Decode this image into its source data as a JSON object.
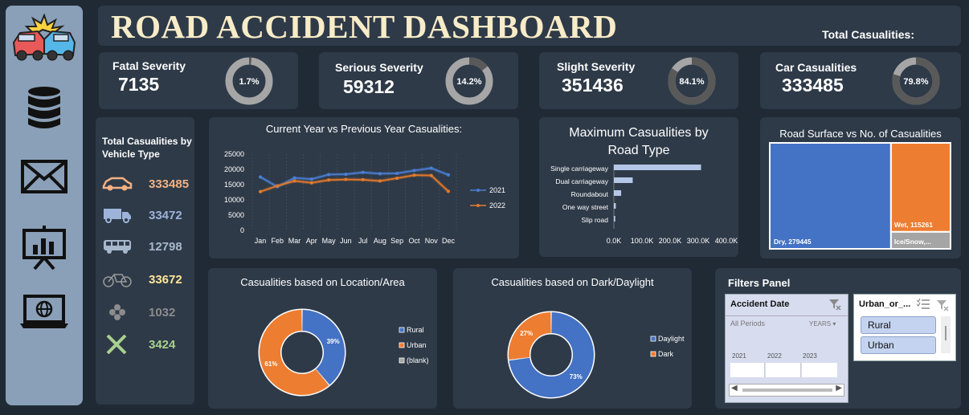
{
  "header": {
    "title": "ROAD ACCIDENT DASHBOARD",
    "total_casualties_label": "Total Casualities:"
  },
  "sidebar": {
    "icons": [
      "car-crash-icon",
      "database-icon",
      "mail-icon",
      "presentation-icon",
      "laptop-globe-icon"
    ]
  },
  "kpis": [
    {
      "label": "Fatal Severity",
      "value": "7135",
      "percent": "1.7%",
      "fraction": 0.017
    },
    {
      "label": "Serious Severity",
      "value": "59312",
      "percent": "14.2%",
      "fraction": 0.142
    },
    {
      "label": "Slight Severity",
      "value": "351436",
      "percent": "84.1%",
      "fraction": 0.841
    },
    {
      "label": "Car Casualities",
      "value": "333485",
      "percent": "79.8%",
      "fraction": 0.798
    }
  ],
  "vehicle_panel": {
    "title": "Total Casualities by Vehicle Type",
    "items": [
      {
        "icon": "car-icon",
        "value": "333485",
        "color": "#f4b183"
      },
      {
        "icon": "truck-icon",
        "value": "33472",
        "color": "#9db3d9"
      },
      {
        "icon": "bus-icon",
        "value": "12798",
        "color": "#a8b8cc"
      },
      {
        "icon": "bicycle-icon",
        "value": "33672",
        "color": "#ffe699"
      },
      {
        "icon": "flower-icon",
        "value": "1032",
        "color": "#8c8c8c"
      },
      {
        "icon": "cross-icon",
        "value": "3424",
        "color": "#a9d18e"
      }
    ]
  },
  "filters": {
    "title": "Filters Panel",
    "date_slicer": {
      "title": "Accident Date",
      "period": "All Periods",
      "unit": "YEARS",
      "years": [
        "2021",
        "2022",
        "2023"
      ]
    },
    "urban_slicer": {
      "title": "Urban_or_...",
      "options": [
        "Rural",
        "Urban"
      ]
    }
  },
  "chart_data": [
    {
      "type": "line",
      "title": "Current Year vs Previous Year Casualities:",
      "categories": [
        "Jan",
        "Feb",
        "Mar",
        "Apr",
        "May",
        "Jun",
        "Jul",
        "Aug",
        "Sep",
        "Oct",
        "Nov",
        "Dec"
      ],
      "yticks": [
        "25000",
        "20000",
        "15000",
        "10000",
        "5000",
        "0"
      ],
      "ylim": [
        0,
        25000
      ],
      "series": [
        {
          "name": "2021",
          "color": "#4a7fd4",
          "values": [
            17500,
            14300,
            17200,
            16800,
            18300,
            18400,
            19000,
            18600,
            18700,
            19600,
            20400,
            18200
          ]
        },
        {
          "name": "2022",
          "color": "#e57a2b",
          "values": [
            12700,
            14600,
            16200,
            15600,
            16500,
            16700,
            16600,
            16200,
            17100,
            18100,
            18000,
            12800
          ]
        }
      ]
    },
    {
      "type": "bar",
      "title": "Maximum Casualities by Road Type",
      "categories": [
        "Single carriageway",
        "Dual carriageway",
        "Roundabout",
        "One way street",
        "Slip road"
      ],
      "values": [
        310000,
        67000,
        26000,
        7000,
        5000
      ],
      "xticks": [
        "0.0K",
        "100.0K",
        "200.0K",
        "300.0K",
        "400.0K"
      ],
      "xlim": [
        0,
        400000
      ]
    },
    {
      "type": "treemap",
      "title": "Road Surface vs No. of Casualities",
      "items": [
        {
          "label": "Dry, 279445",
          "value": 279445,
          "color": "#4472c4"
        },
        {
          "label": "Wet, 115261",
          "value": 115261,
          "color": "#ed7d31"
        },
        {
          "label": "Ice/Snow,...",
          "value": 22000,
          "color": "#a5a5a5"
        }
      ]
    },
    {
      "type": "pie",
      "title": "Casualities based on Location/Area",
      "slices": [
        {
          "name": "Rural",
          "value": 39,
          "label": "39%",
          "color": "#4472c4"
        },
        {
          "name": "Urban",
          "value": 61,
          "label": "61%",
          "color": "#ed7d31"
        }
      ],
      "legend": [
        {
          "name": "Rural",
          "color": "#4472c4"
        },
        {
          "name": "Urban",
          "color": "#ed7d31"
        },
        {
          "name": "(blank)",
          "color": "#a5a5a5"
        }
      ]
    },
    {
      "type": "pie",
      "title": "Casualities based on Dark/Daylight",
      "slices": [
        {
          "name": "Daylight",
          "value": 73,
          "label": "73%",
          "color": "#4472c4"
        },
        {
          "name": "Dark",
          "value": 27,
          "label": "27%",
          "color": "#ed7d31"
        }
      ],
      "legend": [
        {
          "name": "Daylight",
          "color": "#4472c4"
        },
        {
          "name": "Dark",
          "color": "#ed7d31"
        }
      ]
    }
  ]
}
